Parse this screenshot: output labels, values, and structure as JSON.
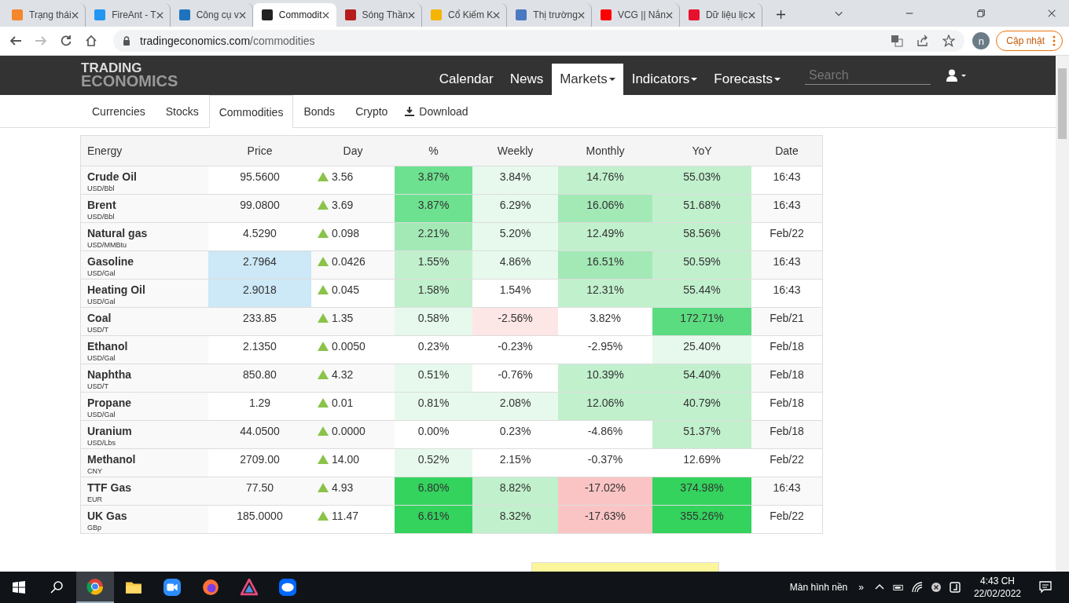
{
  "browser": {
    "tabs": [
      {
        "title": "Trạng thái",
        "color": "#f4862b",
        "selected": false
      },
      {
        "title": "FireAnt - T",
        "color": "#2196f3",
        "selected": false
      },
      {
        "title": "Công cụ v",
        "color": "#1e73be",
        "selected": false
      },
      {
        "title": "Commodit",
        "color": "#222222",
        "selected": true
      },
      {
        "title": "Sóng Thần",
        "color": "#b71c1c",
        "selected": false
      },
      {
        "title": "Cổ Kiếm K",
        "color": "#f5b400",
        "selected": false
      },
      {
        "title": "Thị trường",
        "color": "#4a78c2",
        "selected": false
      },
      {
        "title": "VCG || Nắn",
        "color": "#ff0000",
        "selected": false
      },
      {
        "title": "Dữ liệu lịc",
        "color": "#e8112d",
        "selected": false
      }
    ],
    "url_domain": "tradingeconomics.com",
    "url_path": "/commodities",
    "profile_initial": "n",
    "update_button": "Cập nhật"
  },
  "site": {
    "logo_top": "TRADING",
    "logo_bottom": "ECONOMICS",
    "nav": [
      {
        "label": "Calendar",
        "dropdown": false,
        "selected": false
      },
      {
        "label": "News",
        "dropdown": false,
        "selected": false
      },
      {
        "label": "Markets",
        "dropdown": true,
        "selected": true
      },
      {
        "label": "Indicators",
        "dropdown": true,
        "selected": false
      },
      {
        "label": "Forecasts",
        "dropdown": true,
        "selected": false
      }
    ],
    "search": {
      "placeholder": "Search"
    },
    "subnav": [
      {
        "label": "Currencies",
        "kind": "tab",
        "selected": false
      },
      {
        "label": "Stocks",
        "kind": "tab",
        "selected": false
      },
      {
        "label": "Commodities",
        "kind": "tab",
        "selected": true
      },
      {
        "label": "Bonds",
        "kind": "tab",
        "selected": false
      },
      {
        "label": "Crypto",
        "kind": "tab",
        "selected": false
      },
      {
        "label": "Download",
        "kind": "download",
        "selected": false
      }
    ]
  },
  "table": {
    "columns": [
      "Energy",
      "Price",
      "Day",
      "%",
      "Weekly",
      "Monthly",
      "YoY",
      "Date"
    ],
    "rows": [
      {
        "energy": {
          "name": "Crude Oil",
          "unit": "USD/Bbl"
        },
        "price": {
          "text": "95.5600",
          "highlighted": false
        },
        "day": "3.56",
        "percent": {
          "text": "3.87%",
          "color": "#6de18f"
        },
        "weekly": {
          "text": "3.84%",
          "color": "#e6f9ec"
        },
        "monthly": {
          "text": "14.76%",
          "color": "#c1f0cd"
        },
        "yoy": {
          "text": "55.03%",
          "color": "#c1f0cd"
        },
        "date": "16:43"
      },
      {
        "energy": {
          "name": "Brent",
          "unit": "USD/Bbl"
        },
        "price": {
          "text": "99.0800",
          "highlighted": false
        },
        "day": "3.69",
        "percent": {
          "text": "3.87%",
          "color": "#6de18f"
        },
        "weekly": {
          "text": "6.29%",
          "color": "#e6f9ec"
        },
        "monthly": {
          "text": "16.06%",
          "color": "#a3e9b6"
        },
        "yoy": {
          "text": "51.68%",
          "color": "#c1f0cd"
        },
        "date": "16:43"
      },
      {
        "energy": {
          "name": "Natural gas",
          "unit": "USD/MMBtu"
        },
        "price": {
          "text": "4.5290",
          "highlighted": false
        },
        "day": "0.098",
        "percent": {
          "text": "2.21%",
          "color": "#a3e9b6"
        },
        "weekly": {
          "text": "5.20%",
          "color": "#e6f9ec"
        },
        "monthly": {
          "text": "12.49%",
          "color": "#c1f0cd"
        },
        "yoy": {
          "text": "58.56%",
          "color": "#c1f0cd"
        },
        "date": "Feb/22"
      },
      {
        "energy": {
          "name": "Gasoline",
          "unit": "USD/Gal"
        },
        "price": {
          "text": "2.7964",
          "highlighted": true
        },
        "day": "0.0426",
        "percent": {
          "text": "1.55%",
          "color": "#c1f0cd"
        },
        "weekly": {
          "text": "4.86%",
          "color": "#e6f9ec"
        },
        "monthly": {
          "text": "16.51%",
          "color": "#a3e9b6"
        },
        "yoy": {
          "text": "50.59%",
          "color": "#c1f0cd"
        },
        "date": "16:43"
      },
      {
        "energy": {
          "name": "Heating Oil",
          "unit": "USD/Gal"
        },
        "price": {
          "text": "2.9018",
          "highlighted": true
        },
        "day": "0.045",
        "percent": {
          "text": "1.58%",
          "color": "#c1f0cd"
        },
        "weekly": {
          "text": "1.54%",
          "color": "#ffffff"
        },
        "monthly": {
          "text": "12.31%",
          "color": "#c1f0cd"
        },
        "yoy": {
          "text": "55.44%",
          "color": "#c1f0cd"
        },
        "date": "16:43"
      },
      {
        "energy": {
          "name": "Coal",
          "unit": "USD/T"
        },
        "price": {
          "text": "233.85",
          "highlighted": false
        },
        "day": "1.35",
        "percent": {
          "text": "0.58%",
          "color": "#e6f9ec"
        },
        "weekly": {
          "text": "-2.56%",
          "color": "#fde6e6"
        },
        "monthly": {
          "text": "3.82%",
          "color": "#ffffff"
        },
        "yoy": {
          "text": "172.71%",
          "color": "#5cdc80"
        },
        "date": "Feb/21"
      },
      {
        "energy": {
          "name": "Ethanol",
          "unit": "USD/Gal"
        },
        "price": {
          "text": "2.1350",
          "highlighted": false
        },
        "day": "0.0050",
        "percent": {
          "text": "0.23%",
          "color": "#ffffff"
        },
        "weekly": {
          "text": "-0.23%",
          "color": "#ffffff"
        },
        "monthly": {
          "text": "-2.95%",
          "color": "#ffffff"
        },
        "yoy": {
          "text": "25.40%",
          "color": "#e6f9ec"
        },
        "date": "Feb/18"
      },
      {
        "energy": {
          "name": "Naphtha",
          "unit": "USD/T"
        },
        "price": {
          "text": "850.80",
          "highlighted": false
        },
        "day": "4.32",
        "percent": {
          "text": "0.51%",
          "color": "#e6f9ec"
        },
        "weekly": {
          "text": "-0.76%",
          "color": "#ffffff"
        },
        "monthly": {
          "text": "10.39%",
          "color": "#c1f0cd"
        },
        "yoy": {
          "text": "54.40%",
          "color": "#c1f0cd"
        },
        "date": "Feb/18"
      },
      {
        "energy": {
          "name": "Propane",
          "unit": "USD/Gal"
        },
        "price": {
          "text": "1.29",
          "highlighted": false
        },
        "day": "0.01",
        "percent": {
          "text": "0.81%",
          "color": "#e6f9ec"
        },
        "weekly": {
          "text": "2.08%",
          "color": "#e6f9ec"
        },
        "monthly": {
          "text": "12.06%",
          "color": "#c1f0cd"
        },
        "yoy": {
          "text": "40.79%",
          "color": "#c1f0cd"
        },
        "date": "Feb/18"
      },
      {
        "energy": {
          "name": "Uranium",
          "unit": "USD/Lbs"
        },
        "price": {
          "text": "44.0500",
          "highlighted": false
        },
        "day": "0.0000",
        "percent": {
          "text": "0.00%",
          "color": "#ffffff"
        },
        "weekly": {
          "text": "0.23%",
          "color": "#ffffff"
        },
        "monthly": {
          "text": "-4.86%",
          "color": "#ffffff"
        },
        "yoy": {
          "text": "51.37%",
          "color": "#c1f0cd"
        },
        "date": "Feb/18"
      },
      {
        "energy": {
          "name": "Methanol",
          "unit": "CNY"
        },
        "price": {
          "text": "2709.00",
          "highlighted": false
        },
        "day": "14.00",
        "percent": {
          "text": "0.52%",
          "color": "#e6f9ec"
        },
        "weekly": {
          "text": "2.15%",
          "color": "#ffffff"
        },
        "monthly": {
          "text": "-0.37%",
          "color": "#ffffff"
        },
        "yoy": {
          "text": "12.69%",
          "color": "#ffffff"
        },
        "date": "Feb/22"
      },
      {
        "energy": {
          "name": "TTF Gas",
          "unit": "EUR"
        },
        "price": {
          "text": "77.50",
          "highlighted": false
        },
        "day": "4.93",
        "percent": {
          "text": "6.80%",
          "color": "#33d35d"
        },
        "weekly": {
          "text": "8.82%",
          "color": "#c1f0cd"
        },
        "monthly": {
          "text": "-17.02%",
          "color": "#fbc4c4"
        },
        "yoy": {
          "text": "374.98%",
          "color": "#33d35d"
        },
        "date": "16:43"
      },
      {
        "energy": {
          "name": "UK Gas",
          "unit": "GBp"
        },
        "price": {
          "text": "185.0000",
          "highlighted": false
        },
        "day": "11.47",
        "percent": {
          "text": "6.61%",
          "color": "#33d35d"
        },
        "weekly": {
          "text": "8.32%",
          "color": "#c1f0cd"
        },
        "monthly": {
          "text": "-17.63%",
          "color": "#fbc4c4"
        },
        "yoy": {
          "text": "355.26%",
          "color": "#33d35d"
        },
        "date": "Feb/22"
      }
    ]
  },
  "taskbar": {
    "desktop_label": "Màn hình nền",
    "chevron": "»",
    "time": "4:43 CH",
    "date": "22/02/2022"
  }
}
